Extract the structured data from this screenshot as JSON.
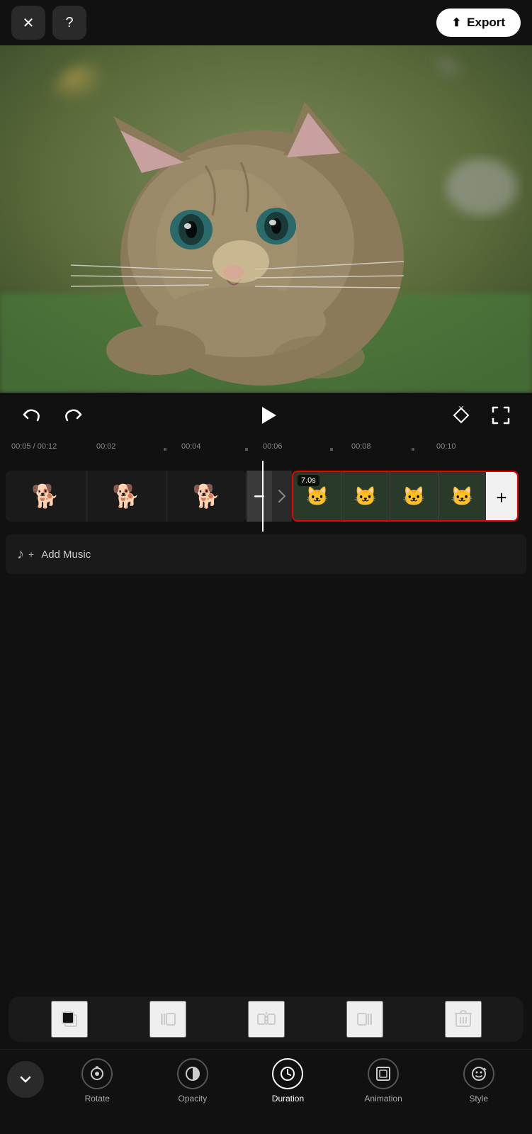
{
  "header": {
    "close_label": "✕",
    "help_label": "?",
    "export_label": "Export",
    "export_icon": "↑"
  },
  "controls": {
    "undo_icon": "↩",
    "redo_icon": "↪",
    "play_icon": "▶",
    "diamond_icon": "◇",
    "fullscreen_icon": "⛶"
  },
  "timeline": {
    "current_time": "00:05",
    "total_time": "00:12",
    "markers": [
      "00:02",
      "00:04",
      "00:06",
      "00:08",
      "00:10"
    ]
  },
  "clips": {
    "dog_clip": {
      "frames": [
        "🐕",
        "🐕",
        "🐕"
      ]
    },
    "cat_clip": {
      "duration_badge": "7.0s",
      "frames": [
        "🐱",
        "🐱",
        "🐱",
        "🐱"
      ]
    }
  },
  "add_music": {
    "label": "Add Music",
    "icon": "♫+"
  },
  "toolbar_tools": [
    {
      "name": "copy",
      "icon": "⧉"
    },
    {
      "name": "trim-left",
      "icon": "⸢"
    },
    {
      "name": "split",
      "icon": "⸠"
    },
    {
      "name": "trim-right",
      "icon": "⸣"
    },
    {
      "name": "delete",
      "icon": "🗑"
    }
  ],
  "bottom_nav": {
    "collapse_icon": "∨",
    "items": [
      {
        "id": "rotate",
        "label": "Rotate",
        "icon": "⊙"
      },
      {
        "id": "opacity",
        "label": "Opacity",
        "icon": "◑"
      },
      {
        "id": "duration",
        "label": "Duration",
        "icon": "🕐"
      },
      {
        "id": "animation",
        "label": "Animation",
        "icon": "▣"
      },
      {
        "id": "style",
        "label": "Style",
        "icon": "☺"
      }
    ]
  },
  "colors": {
    "accent_red": "#e00000",
    "bg_dark": "#111111",
    "bg_medium": "#1a1a1a",
    "text_light": "#cccccc",
    "white": "#ffffff"
  }
}
